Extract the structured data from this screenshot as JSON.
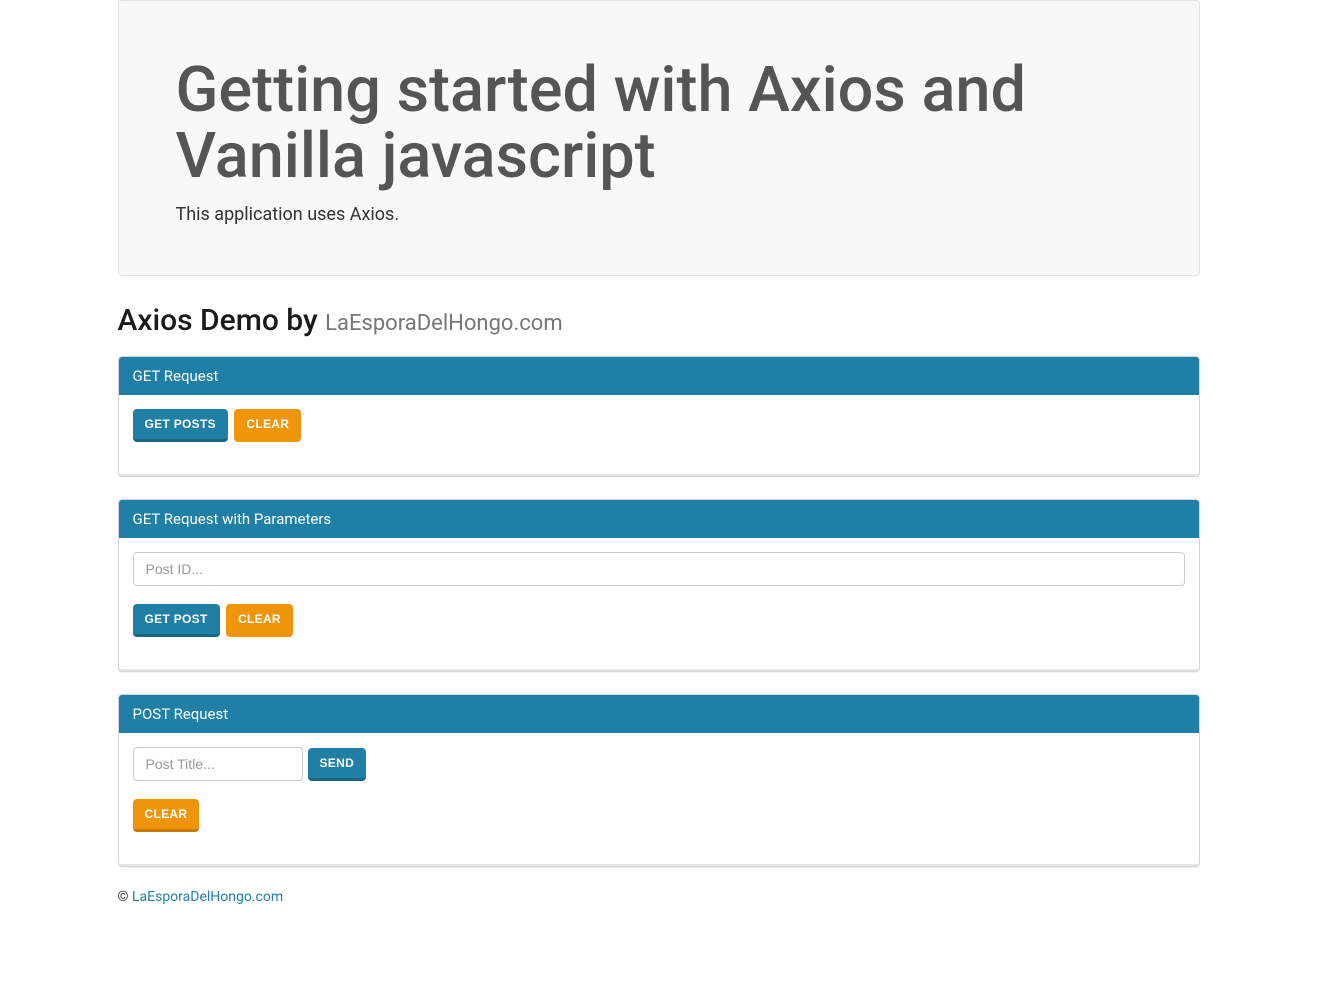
{
  "jumbotron": {
    "title": "Getting started with Axios and Vanilla javascript",
    "subtitle": "This application uses Axios."
  },
  "subheading": {
    "prefix": "Axios Demo by ",
    "author": "LaEsporaDelHongo.com"
  },
  "panel1": {
    "title": "GET Request",
    "getPostsLabel": "GET POSTS",
    "clearLabel": "CLEAR"
  },
  "panel2": {
    "title": "GET Request with Parameters",
    "placeholder": "Post ID...",
    "getPostLabel": "GET POST",
    "clearLabel": "CLEAR"
  },
  "panel3": {
    "title": "POST Request",
    "placeholder": "Post Title...",
    "sendLabel": "SEND",
    "clearLabel": "CLEAR"
  },
  "footer": {
    "copyright": "© ",
    "linkText": "LaEsporaDelHongo.com"
  }
}
